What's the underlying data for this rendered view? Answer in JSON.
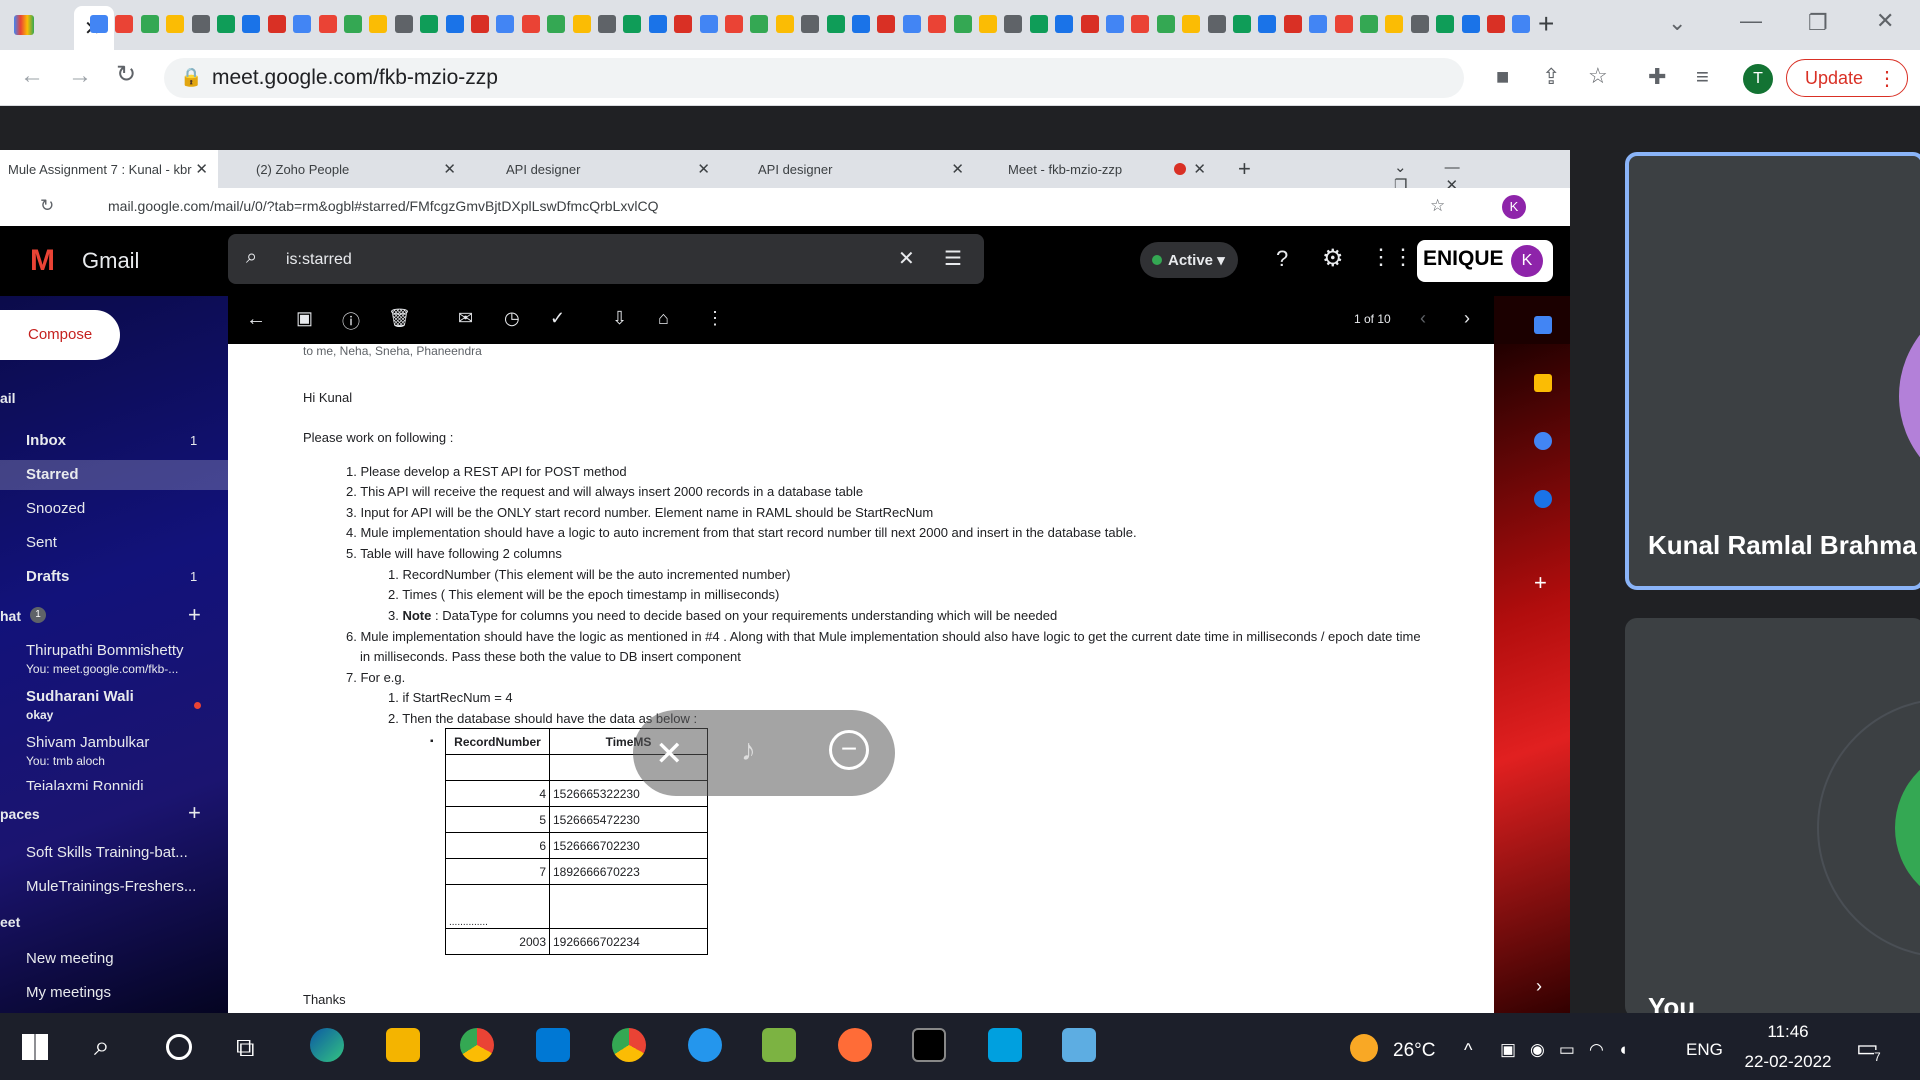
{
  "outer_browser": {
    "url": "meet.google.com/fkb-mzio-zzp",
    "update_label": "Update",
    "avatar_letter": "T",
    "tab_close": "✕",
    "new_tab": "+"
  },
  "inner_browser": {
    "tabs": [
      {
        "label": "Mule Assignment 7 : Kunal - kbr"
      },
      {
        "label": "(2) Zoho People"
      },
      {
        "label": "API designer"
      },
      {
        "label": "API designer"
      },
      {
        "label": "Meet - fkb-mzio-zzp"
      }
    ],
    "url": "mail.google.com/mail/u/0/?tab=rm&ogbl#starred/FMfcgzGmvBjtDXplLswDfmcQrbLxvlCQ"
  },
  "gmail": {
    "product_name": "Gmail",
    "search_value": "is:starred",
    "status": "Active",
    "brand_badge": "ENIQUE",
    "account_letter": "K",
    "compose_label": "Compose",
    "page_count": "1 of 10",
    "sidebar": {
      "mail_header": "ail",
      "items": [
        {
          "label": "Inbox",
          "count": "1"
        },
        {
          "label": "Starred",
          "count": ""
        },
        {
          "label": "Snoozed",
          "count": ""
        },
        {
          "label": "Sent",
          "count": ""
        },
        {
          "label": "Drafts",
          "count": "1"
        }
      ],
      "chat_header": "hat",
      "chat_badge": "1",
      "chats": [
        {
          "name": "Thirupathi Bommishetty",
          "sub": "You: meet.google.com/fkb-..."
        },
        {
          "name": "Sudharani Wali",
          "sub": "okay"
        },
        {
          "name": "Shivam Jambulkar",
          "sub": "You: tmb aloch"
        },
        {
          "name": "Tejalaxmi Ronnidi",
          "sub": ""
        }
      ],
      "spaces_header": "paces",
      "spaces": [
        "Soft Skills Training-bat...",
        "MuleTrainings-Freshers..."
      ],
      "meet_header": "eet",
      "meet_items": [
        "New meeting",
        "My meetings"
      ]
    },
    "email": {
      "recipients": "to me, Neha, Sneha, Phaneendra",
      "greeting": "Hi Kunal",
      "intro": "Please work on following :",
      "items": [
        "1. Please develop a REST API for POST method",
        "2. This API will receive the request and will always insert 2000 records in a database table",
        "3. Input for API will be the ONLY start record number. Element name in RAML should be  StartRecNum",
        "4. Mule implementation should have a logic to auto increment from that  start record number till next 2000 and insert in the database table.",
        "5. Table will have following 2 columns"
      ],
      "subitems": [
        "1. RecordNumber (This element will be the auto incremented number)",
        "2. Times ( This element will be the epoch timestamp in milliseconds)"
      ],
      "note_label": "Note",
      "note_text": " : DataType for columns you need to decide based on your requirements understanding which will be needed",
      "note_prefix": "3. ",
      "item6_line1": "6. Mule implementation should have the logic as mentioned in #4 . Along with that Mule implementation should also have logic to get the current date time in milliseconds / epoch date time",
      "item6_line2": "in milliseconds. Pass these both the value to DB insert component",
      "item7": "7. For e.g.",
      "eg1": "1. if  StartRecNum  = 4",
      "eg2": "2. Then the database should have the data as below :",
      "bullet": "▪",
      "table": {
        "headers": [
          "RecordNumber",
          "TimeMS"
        ],
        "rows": [
          [
            "",
            ""
          ],
          [
            "4",
            "1526665322230"
          ],
          [
            "5",
            "1526665472230"
          ],
          [
            "6",
            "1526666702230"
          ],
          [
            "7",
            "1892666670223"
          ],
          [
            "..............",
            ""
          ],
          [
            "2003",
            "1926666702234"
          ]
        ]
      },
      "closing": "Thanks"
    }
  },
  "meet": {
    "tile1_name": "Kunal Ramlal Brahma",
    "tile2_name": "You"
  },
  "taskbar": {
    "temperature": "26°C",
    "language": "ENG",
    "time": "11:46",
    "date": "22-02-2022",
    "notification_count": "7"
  },
  "colors": {
    "update_red": "#d93025",
    "active_tile_border": "#8ab4f8",
    "gmail_sidebar": "#12127a"
  }
}
